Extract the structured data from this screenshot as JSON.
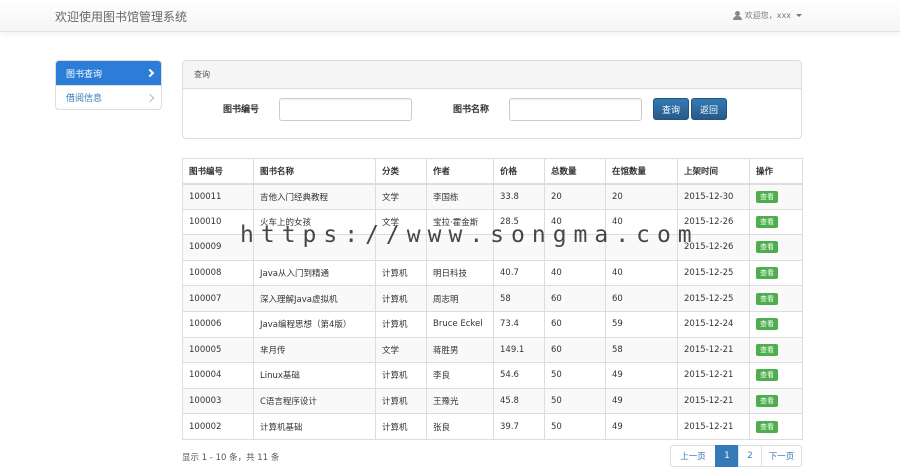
{
  "navbar": {
    "title": "欢迎使用图书馆管理系统",
    "user_label": "欢迎您，xxx"
  },
  "sidebar": {
    "items": [
      {
        "label": "图书查询",
        "active": true
      },
      {
        "label": "借阅信息",
        "active": false
      }
    ]
  },
  "search": {
    "panel_title": "查询",
    "book_id_label": "图书编号",
    "book_id_value": "",
    "book_name_label": "图书名称",
    "book_name_value": "",
    "query_button": "查询",
    "back_button": "返回"
  },
  "table": {
    "headers": [
      "图书编号",
      "图书名称",
      "分类",
      "作者",
      "价格",
      "总数量",
      "在馆数量",
      "上架时间",
      "操作"
    ],
    "view_label": "查看",
    "rows": [
      [
        "100011",
        "吉他入门经典教程",
        "文学",
        "李国栋",
        "33.8",
        "20",
        "20",
        "2015-12-30"
      ],
      [
        "100010",
        "火车上的女孩",
        "文学",
        "宝拉·霍金斯",
        "28.5",
        "40",
        "40",
        "2015-12-26"
      ],
      [
        "100009",
        "",
        "",
        "",
        "",
        "",
        "",
        "2015-12-26"
      ],
      [
        "100008",
        "Java从入门到精通",
        "计算机",
        "明日科技",
        "40.7",
        "40",
        "40",
        "2015-12-25"
      ],
      [
        "100007",
        "深入理解Java虚拟机",
        "计算机",
        "周志明",
        "58",
        "60",
        "60",
        "2015-12-25"
      ],
      [
        "100006",
        "Java编程思想（第4版）",
        "计算机",
        "Bruce Eckel",
        "73.4",
        "60",
        "59",
        "2015-12-24"
      ],
      [
        "100005",
        "芈月传",
        "文学",
        "蒋胜男",
        "149.1",
        "60",
        "58",
        "2015-12-21"
      ],
      [
        "100004",
        "Linux基础",
        "计算机",
        "李良",
        "54.6",
        "50",
        "49",
        "2015-12-21"
      ],
      [
        "100003",
        "C语言程序设计",
        "计算机",
        "王豫光",
        "45.8",
        "50",
        "49",
        "2015-12-21"
      ],
      [
        "100002",
        "计算机基础",
        "计算机",
        "张良",
        "39.7",
        "50",
        "49",
        "2015-12-21"
      ]
    ]
  },
  "footer": {
    "summary": "显示 1 - 10 条，共 11 条",
    "prev": "上一页",
    "pages": [
      "1",
      "2"
    ],
    "active_page": "1",
    "next": "下一页"
  },
  "watermark": "https://www.songma.com",
  "colors": {
    "primary": "#337ab7",
    "sidebar_active": "#2b7dd7",
    "view_button": "#4cae4c"
  }
}
